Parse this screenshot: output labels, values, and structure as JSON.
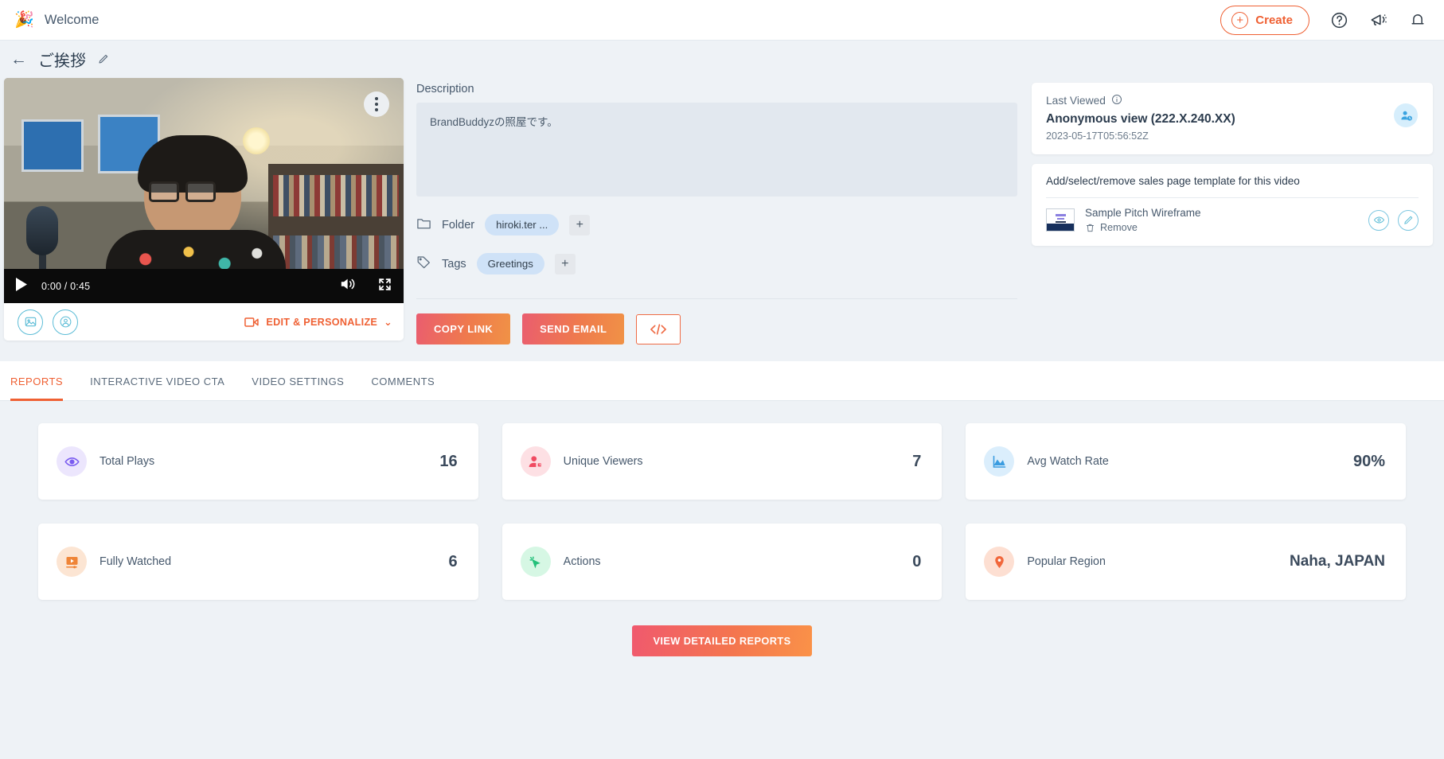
{
  "topbar": {
    "brand_emoji": "🎉",
    "brand_title": "Welcome",
    "create_label": "Create",
    "plus_glyph": "+",
    "help_icon": "help-circle-icon",
    "announce_icon": "megaphone-icon",
    "bell_icon": "bell-icon"
  },
  "subbar": {
    "back_glyph": "←",
    "page_title": "ご挨拶",
    "edit_icon": "pencil-icon"
  },
  "video": {
    "menu_icon": "kebab-menu-icon",
    "play_icon": "play-icon",
    "time": "0:00 / 0:45",
    "volume_icon": "volume-icon",
    "fullscreen_icon": "fullscreen-icon",
    "thumbnail_icon": "image-icon",
    "personalize_icon": "avatar-overlay-icon",
    "edit_personalize_label": "EDIT & PERSONALIZE",
    "edit_personalize_caret": "⌄"
  },
  "details": {
    "description_label": "Description",
    "description_text": "BrandBuddyzの照屋です。",
    "folder_label": "Folder",
    "folder_chip": "hiroki.ter ...",
    "tags_label": "Tags",
    "tag_chip": "Greetings",
    "add_glyph": "+"
  },
  "actions": {
    "copy_link": "COPY LINK",
    "send_email": "SEND EMAIL",
    "embed_icon": "embed-code-icon"
  },
  "last_viewed": {
    "label": "Last Viewed",
    "info_icon": "info-icon",
    "viewer": "Anonymous view (222.X.240.XX)",
    "timestamp": "2023-05-17T05:56:52Z",
    "avatar_icon": "user-clock-icon"
  },
  "template": {
    "heading": "Add/select/remove sales page template for this video",
    "name": "Sample Pitch Wireframe",
    "remove_label": "Remove",
    "remove_icon": "trash-icon",
    "preview_icon": "eye-icon",
    "edit_icon": "pencil-icon"
  },
  "tabs": [
    {
      "label": "REPORTS",
      "active": true
    },
    {
      "label": "INTERACTIVE VIDEO CTA",
      "active": false
    },
    {
      "label": "VIDEO SETTINGS",
      "active": false
    },
    {
      "label": "COMMENTS",
      "active": false
    }
  ],
  "stats": [
    {
      "label": "Total Plays",
      "value": "16",
      "icon": "eye-icon",
      "bg": "#ece6fd",
      "fg": "#7a5cf0"
    },
    {
      "label": "Unique Viewers",
      "value": "7",
      "icon": "user-tag-icon",
      "bg": "#fde0e4",
      "fg": "#f04b62"
    },
    {
      "label": "Avg Watch Rate",
      "value": "90%",
      "icon": "area-chart-icon",
      "bg": "#dbeefc",
      "fg": "#3a9ce0"
    },
    {
      "label": "Fully Watched",
      "value": "6",
      "icon": "video-play-icon",
      "bg": "#fce5d3",
      "fg": "#ef8437"
    },
    {
      "label": "Actions",
      "value": "0",
      "icon": "click-icon",
      "bg": "#d6f7e4",
      "fg": "#24c07a"
    },
    {
      "label": "Popular Region",
      "value": "Naha, JAPAN",
      "icon": "map-pin-icon",
      "bg": "#fddfd2",
      "fg": "#f1673b"
    }
  ],
  "footer": {
    "view_reports": "VIEW DETAILED REPORTS"
  },
  "colors": {
    "accent": "#ef6033",
    "gradient_start": "#ea5d6f",
    "gradient_end": "#f09246",
    "chip_blue": "#cfe2f7"
  }
}
